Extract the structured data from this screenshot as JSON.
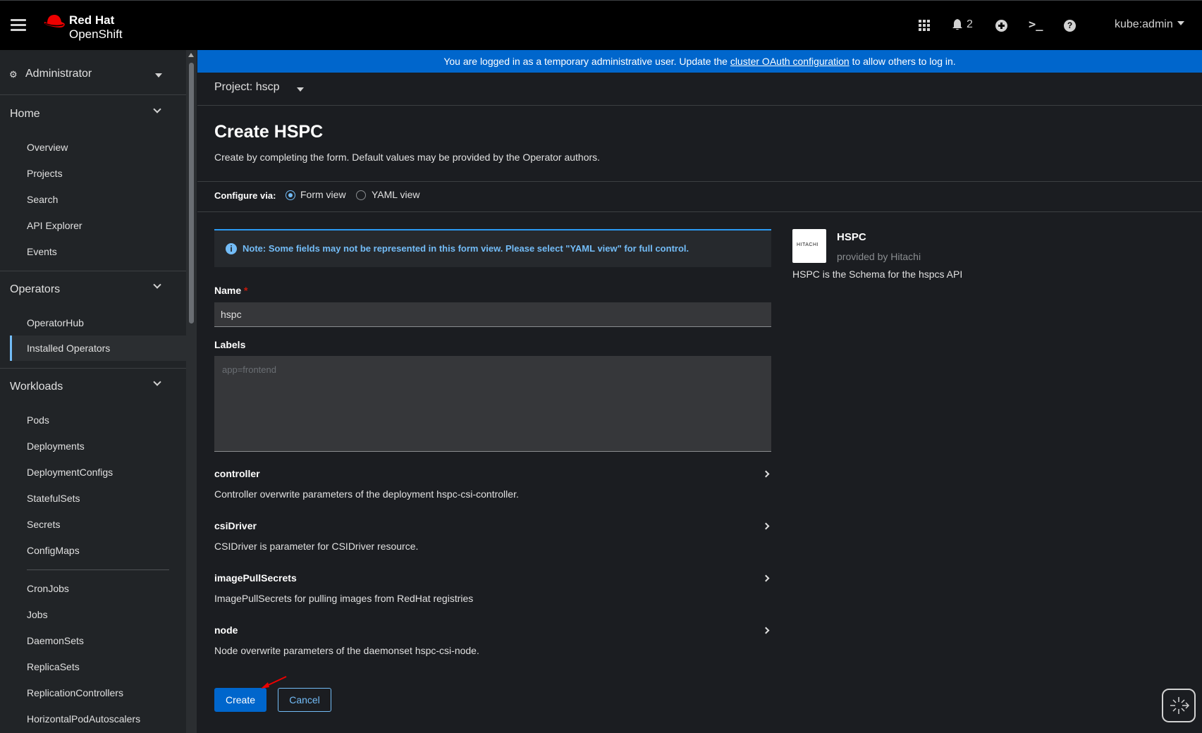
{
  "masthead": {
    "brand_line1": "Red Hat",
    "brand_line2": "OpenShift",
    "notifications_count": "2",
    "user": "kube:admin"
  },
  "sidebar": {
    "perspective": "Administrator",
    "sections": [
      {
        "title": "Home",
        "items": [
          "Overview",
          "Projects",
          "Search",
          "API Explorer",
          "Events"
        ]
      },
      {
        "title": "Operators",
        "items": [
          "OperatorHub",
          "Installed Operators"
        ]
      },
      {
        "title": "Workloads",
        "items": [
          "Pods",
          "Deployments",
          "DeploymentConfigs",
          "StatefulSets",
          "Secrets",
          "ConfigMaps",
          "CronJobs",
          "Jobs",
          "DaemonSets",
          "ReplicaSets",
          "ReplicationControllers",
          "HorizontalPodAutoscalers"
        ]
      }
    ],
    "active_item": "Installed Operators"
  },
  "banner": {
    "text_before": "You are logged in as a temporary administrative user. Update the ",
    "link": "cluster OAuth configuration",
    "text_after": " to allow others to log in."
  },
  "project": {
    "label": "Project: hscp"
  },
  "page": {
    "title": "Create HSPC",
    "description": "Create by completing the form. Default values may be provided by the Operator authors."
  },
  "configure_via": {
    "label": "Configure via:",
    "options": [
      "Form view",
      "YAML view"
    ],
    "selected": "Form view"
  },
  "alert": {
    "text": "Note: Some fields may not be represented in this form view. Please select \"YAML view\" for full control."
  },
  "form": {
    "name_label": "Name",
    "name_required": "*",
    "name_value": "hspc",
    "labels_label": "Labels",
    "labels_placeholder": "app=frontend",
    "expanders": [
      {
        "name": "controller",
        "description": "Controller overwrite parameters of the deployment hspc-csi-controller."
      },
      {
        "name": "csiDriver",
        "description": "CSIDriver is parameter for CSIDriver resource."
      },
      {
        "name": "imagePullSecrets",
        "description": "ImagePullSecrets for pulling images from RedHat registries"
      },
      {
        "name": "node",
        "description": "Node overwrite parameters of the daemonset hspc-csi-node."
      }
    ],
    "create_label": "Create",
    "cancel_label": "Cancel"
  },
  "side_card": {
    "logo_text": "HITACHI",
    "title": "HSPC",
    "provider": "provided by Hitachi",
    "description": "HSPC is the Schema for the hspcs API"
  },
  "colors": {
    "masthead_bg": "#000000",
    "banner_bg": "#0066cc",
    "primary": "#0066cc",
    "link": "#73bcf7",
    "required": "#c9190b"
  }
}
